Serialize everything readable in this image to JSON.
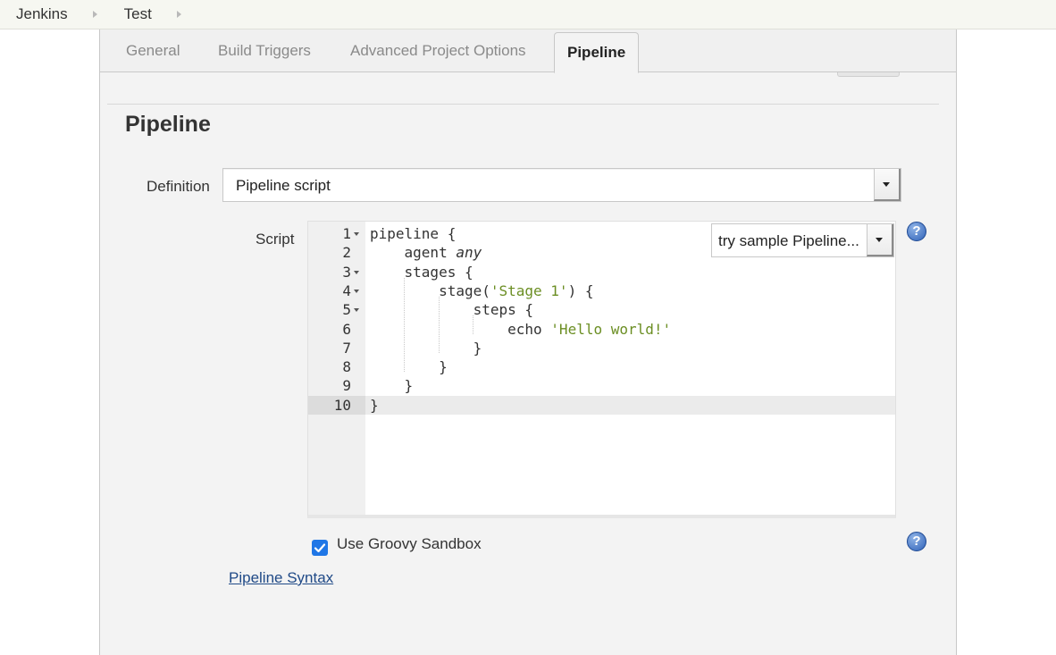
{
  "breadcrumb": {
    "items": [
      {
        "label": "Jenkins"
      },
      {
        "label": "Test"
      }
    ]
  },
  "tabs": [
    {
      "label": "General",
      "active": false
    },
    {
      "label": "Build Triggers",
      "active": false
    },
    {
      "label": "Advanced Project Options",
      "active": false
    },
    {
      "label": "Pipeline",
      "active": true
    }
  ],
  "section": {
    "title": "Pipeline"
  },
  "definition": {
    "label": "Definition",
    "selected": "Pipeline script"
  },
  "script": {
    "label": "Script",
    "sample_selected": "try sample Pipeline...",
    "active_line": 10,
    "lines": [
      {
        "n": "1",
        "tokens": [
          {
            "t": "pipeline ",
            "c": "kw"
          },
          {
            "t": "{",
            "c": "kw"
          }
        ]
      },
      {
        "n": "2",
        "tokens": [
          {
            "t": "    agent ",
            "c": "kw"
          },
          {
            "t": "any",
            "c": "it"
          }
        ]
      },
      {
        "n": "3",
        "tokens": [
          {
            "t": "    stages {",
            "c": "kw"
          }
        ]
      },
      {
        "n": "4",
        "tokens": [
          {
            "t": "        stage(",
            "c": "kw"
          },
          {
            "t": "'Stage 1'",
            "c": "str"
          },
          {
            "t": ") {",
            "c": "kw"
          }
        ]
      },
      {
        "n": "5",
        "tokens": [
          {
            "t": "            steps {",
            "c": "kw"
          }
        ]
      },
      {
        "n": "6",
        "tokens": [
          {
            "t": "                echo ",
            "c": "kw"
          },
          {
            "t": "'Hello world!'",
            "c": "str"
          }
        ]
      },
      {
        "n": "7",
        "tokens": [
          {
            "t": "            }",
            "c": "kw"
          }
        ]
      },
      {
        "n": "8",
        "tokens": [
          {
            "t": "        }",
            "c": "kw"
          }
        ]
      },
      {
        "n": "9",
        "tokens": [
          {
            "t": "    }",
            "c": "kw"
          }
        ]
      },
      {
        "n": "10",
        "tokens": [
          {
            "t": "}",
            "c": "kw"
          }
        ]
      }
    ],
    "foldable_lines": [
      "1",
      "3",
      "4",
      "5"
    ]
  },
  "help": {
    "script_icon": "?",
    "sandbox_icon": "?"
  },
  "sandbox": {
    "label": "Use Groovy Sandbox",
    "checked": true
  },
  "links": {
    "pipeline_syntax": "Pipeline Syntax"
  },
  "colors": {
    "checkbox": "#1f76e6",
    "link": "#204a87",
    "string": "#6b8e23",
    "help": "#2f62b8"
  }
}
